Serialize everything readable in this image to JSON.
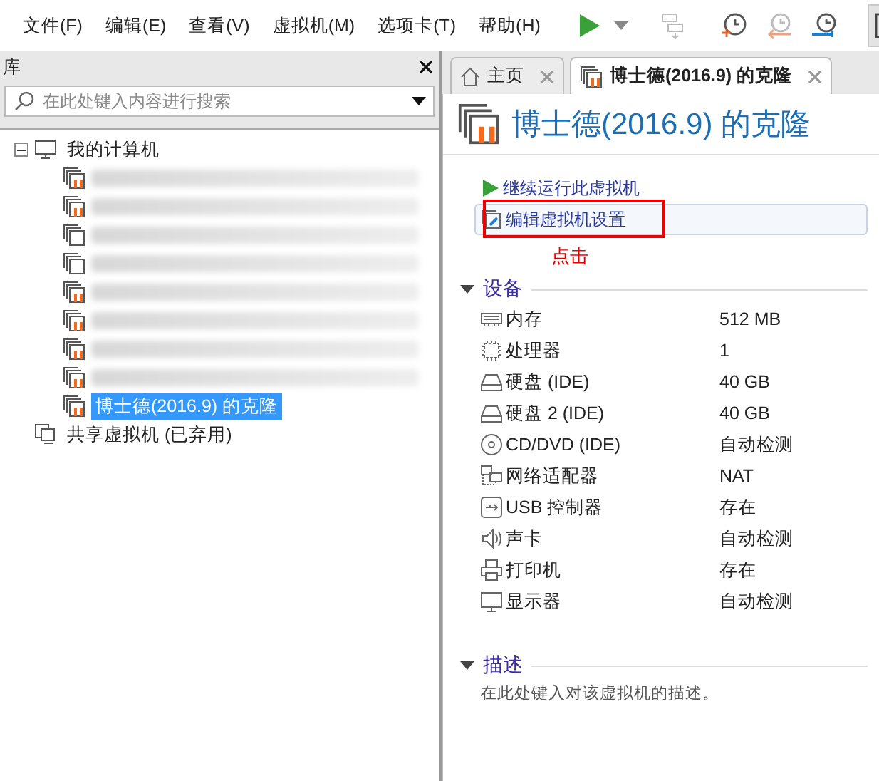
{
  "menu": [
    "文件(F)",
    "编辑(E)",
    "查看(V)",
    "虚拟机(M)",
    "选项卡(T)",
    "帮助(H)"
  ],
  "toolbar": [
    {
      "kind": "play"
    },
    {
      "kind": "caret"
    },
    {
      "kind": "sep"
    },
    {
      "kind": "send-keys",
      "disabled": true
    },
    {
      "kind": "sep"
    },
    {
      "kind": "snapshot-take"
    },
    {
      "kind": "snapshot-revert"
    },
    {
      "kind": "snapshot-manage"
    },
    {
      "kind": "sep"
    },
    {
      "kind": "sidebar",
      "selected": true
    }
  ],
  "library": {
    "title": "库",
    "search": {
      "placeholder": "在此处键入内容进行搜索"
    },
    "tree": [
      {
        "label": "我的计算机",
        "kind": "computer",
        "expanded": true,
        "children": [
          {
            "kind": "vm",
            "redacted": true,
            "suspended": true,
            "selected": false
          },
          {
            "kind": "vm",
            "redacted": true,
            "suspended": true,
            "selected": false
          },
          {
            "kind": "vm",
            "redacted": true,
            "suspended": false,
            "selected": false
          },
          {
            "kind": "vm",
            "redacted": true,
            "suspended": false,
            "selected": false
          },
          {
            "kind": "vm",
            "redacted": true,
            "suspended": true,
            "selected": false
          },
          {
            "kind": "vm",
            "redacted": true,
            "suspended": true,
            "selected": false
          },
          {
            "kind": "vm",
            "redacted": true,
            "suspended": true,
            "selected": false
          },
          {
            "kind": "vm",
            "redacted": true,
            "suspended": true,
            "selected": false
          },
          {
            "kind": "vm",
            "label": "博士德(2016.9) 的克隆",
            "suspended": true,
            "selected": true
          }
        ]
      },
      {
        "label": "共享虚拟机 (已弃用)",
        "kind": "shared"
      }
    ]
  },
  "tabs": [
    {
      "label": "主页",
      "kind": "home",
      "selected": false
    },
    {
      "label": "博士德(2016.9) 的克隆",
      "kind": "vm",
      "selected": true
    }
  ],
  "vm": {
    "title": "博士德(2016.9) 的克隆",
    "actions": [
      {
        "label": "继续运行此虚拟机",
        "kind": "play",
        "highlighted": false
      },
      {
        "label": "编辑虚拟机设置",
        "kind": "edit",
        "highlighted": true
      }
    ],
    "annotation": "点击",
    "devices_title": "设备",
    "devices": [
      {
        "kind": "memory",
        "name": "内存",
        "value": "512 MB"
      },
      {
        "kind": "cpu",
        "name": "处理器",
        "value": "1"
      },
      {
        "kind": "disk",
        "name": "硬盘 (IDE)",
        "value": "40 GB"
      },
      {
        "kind": "disk",
        "name": "硬盘 2 (IDE)",
        "value": "40 GB"
      },
      {
        "kind": "cd",
        "name": "CD/DVD (IDE)",
        "value": "自动检测"
      },
      {
        "kind": "network",
        "name": "网络适配器",
        "value": "NAT"
      },
      {
        "kind": "usb",
        "name": "USB 控制器",
        "value": "存在"
      },
      {
        "kind": "sound",
        "name": "声卡",
        "value": "自动检测"
      },
      {
        "kind": "printer",
        "name": "打印机",
        "value": "存在"
      },
      {
        "kind": "display",
        "name": "显示器",
        "value": "自动检测"
      }
    ],
    "description_title": "描述",
    "description_placeholder": "在此处键入对该虚拟机的描述。"
  }
}
